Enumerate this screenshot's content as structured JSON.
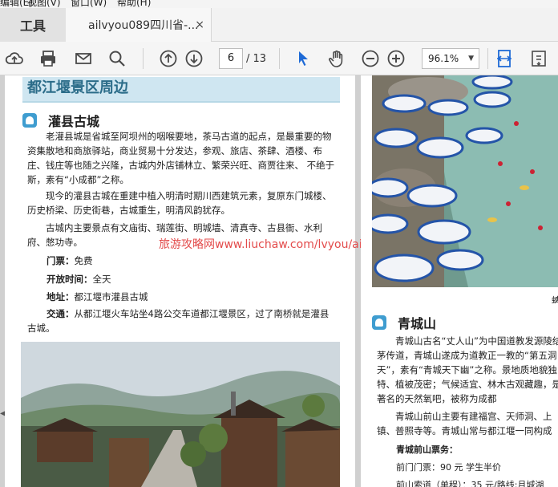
{
  "menubar": {
    "items": [
      "编辑(E)",
      "视图(V)",
      "窗口(W)",
      "帮助(H)"
    ]
  },
  "tabs": {
    "tools_label": "工具",
    "document_label": "ailvyou089四川省-...",
    "close_glyph": "×"
  },
  "toolbar": {
    "icons": [
      "cloud-upload-icon",
      "print-icon",
      "email-icon",
      "search-icon",
      "page-up-icon",
      "page-down-icon",
      "select-cursor-icon",
      "hand-icon",
      "zoom-out-icon",
      "zoom-in-icon",
      "fit-page-icon",
      "tools-icon"
    ],
    "page_current": "6",
    "page_total": "/ 13",
    "zoom": "96.1%"
  },
  "left_page": {
    "section_title": "都江堰景区周边",
    "subsection_title": "灌县古城",
    "paragraphs": [
      "老灌县城是省城至阿坝州的咽喉要地，茶马古道的起点，是最重要的物资集散地和商旅驿站，商业贸易十分发达，参观、旅店、茶肆、酒楼、布庄、钱庄等也随之兴隆，古城内外店铺林立、繁荣兴旺、商贾往来、 不绝于斯，素有“小成都”之称。",
      "现今的灌县古城在重建中植入明清时期川西建筑元素，复原东门城楼、历史桥梁、历史街巷，古城重生，明清风韵犹存。",
      "古城内主要景点有文庙街、瑞莲街、明城墙、清真寺、古县衙、水利府、憋功寺。"
    ],
    "info": [
      {
        "key": "门票：",
        "value": "免费"
      },
      {
        "key": "开放时间：",
        "value": "全天"
      },
      {
        "key": "地址：",
        "value": "都江堰市灌县古城"
      },
      {
        "key": "交通：",
        "value": "从都江堰火车站坐4路公交车道都江堰景区，过了南桥就是灌县古城。"
      }
    ],
    "watermark": "旅游攻略网www.liuchaw.com/lvyou/ailvyou/"
  },
  "right_page": {
    "caption_fragment": "蜱",
    "subsection_title": "青城山",
    "paragraphs": [
      "青城山古名“丈人山”为中国道教发源陵结茅传道，青城山遂成为道教正一教的“第五洞天”，素有“青城天下幽”之称。景地质地貌独特、植被茂密；气候适宜、林木古观藏趣，是著名的天然氧吧，被称为成都",
      "青城山前山主要有建福宫、天师洞、上镇、普照寺等。青城山常与都江堰一同构成"
    ],
    "ticket_title": "青城前山票务：",
    "tickets": [
      "前门门票：90 元 学生半价",
      "前山索道（单程）：35 元/路线:月城湖"
    ]
  }
}
